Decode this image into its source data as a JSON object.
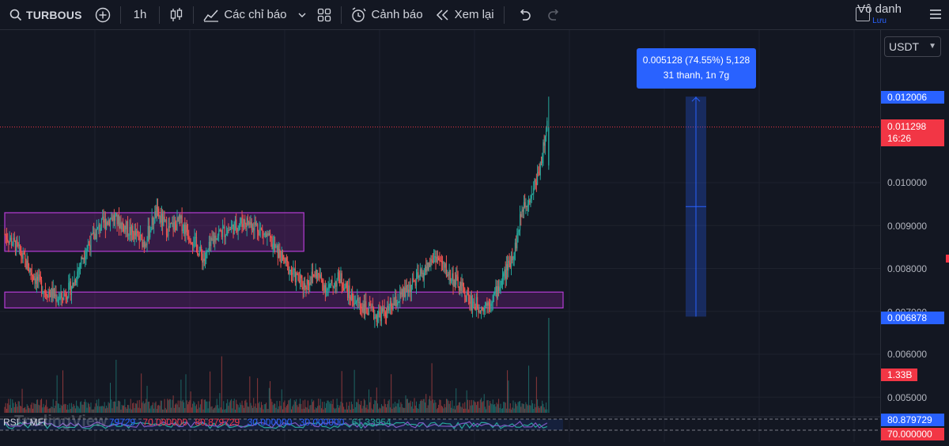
{
  "toolbar": {
    "symbol": "TURBOUS",
    "interval": "1h",
    "indicators_label": "Các chỉ báo",
    "alert_label": "Cảnh báo",
    "replay_label": "Xem lại",
    "user_name": "Vô danh",
    "save_label": "Lưu"
  },
  "icons": [
    "search-icon",
    "add-symbol-icon",
    "candles-icon",
    "indicators-icon",
    "chevron-down-icon",
    "templates-icon",
    "alarm-icon",
    "replay-icon",
    "undo-icon",
    "redo-icon",
    "layout-icon",
    "menu-icon"
  ],
  "colors": {
    "background": "#131722",
    "up": "#26a69a",
    "down": "#ef5350",
    "zone": "#9c27b0",
    "measure": "#2962ff",
    "last_price": "#f23645"
  },
  "price_scale": {
    "currency": "USDT",
    "ticks": [
      "0.010000",
      "0.009000",
      "0.008000",
      "0.007000",
      "0.006000",
      "0.005000"
    ],
    "measure_high": "0.012006",
    "last_price": "0.011298",
    "countdown": "16:26",
    "measure_low": "0.006878",
    "volume": "1.33B",
    "rsi_value": "80.879729",
    "rsi_level": "70.000000"
  },
  "measure": {
    "line1": "0.005128 (74.55%) 5,128",
    "line2": "31 thanh, 1n 7g"
  },
  "rsi_legend": {
    "name": "RSI + MFI",
    "values": [
      "79729",
      "70.000000",
      "80.879729",
      "30.000000",
      "30.000000",
      "61.33954"
    ]
  },
  "watermark": "TradingView",
  "chart_data": {
    "type": "candlestick",
    "symbol": "TURBOUS",
    "interval": "1h",
    "currency": "USDT",
    "ylim": [
      0.0045,
      0.0128
    ],
    "ticks": [
      0.01,
      0.009,
      0.008,
      0.007,
      0.006,
      0.005
    ],
    "last_price": 0.011298,
    "path": [
      [
        0,
        0.0088
      ],
      [
        3,
        0.0085
      ],
      [
        6,
        0.008
      ],
      [
        10,
        0.0075
      ],
      [
        14,
        0.0073
      ],
      [
        17,
        0.0076
      ],
      [
        20,
        0.0084
      ],
      [
        24,
        0.009
      ],
      [
        27,
        0.0092
      ],
      [
        31,
        0.0089
      ],
      [
        35,
        0.0086
      ],
      [
        38,
        0.0093
      ],
      [
        41,
        0.0089
      ],
      [
        44,
        0.0091
      ],
      [
        47,
        0.0087
      ],
      [
        50,
        0.0082
      ],
      [
        53,
        0.0088
      ],
      [
        56,
        0.0089
      ],
      [
        60,
        0.0091
      ],
      [
        63,
        0.009
      ],
      [
        66,
        0.0087
      ],
      [
        69,
        0.0083
      ],
      [
        72,
        0.0079
      ],
      [
        75,
        0.0076
      ],
      [
        78,
        0.0079
      ],
      [
        81,
        0.0075
      ],
      [
        84,
        0.0078
      ],
      [
        87,
        0.0073
      ],
      [
        90,
        0.0071
      ],
      [
        93,
        0.0069
      ],
      [
        96,
        0.007
      ],
      [
        99,
        0.0073
      ],
      [
        102,
        0.0076
      ],
      [
        105,
        0.0079
      ],
      [
        108,
        0.0083
      ],
      [
        111,
        0.0079
      ],
      [
        114,
        0.0076
      ],
      [
        117,
        0.0072
      ],
      [
        120,
        0.0071
      ],
      [
        123,
        0.0074
      ],
      [
        126,
        0.008
      ],
      [
        128,
        0.0085
      ],
      [
        130,
        0.0095
      ],
      [
        132,
        0.0097
      ],
      [
        134,
        0.0103
      ],
      [
        135,
        0.0108
      ],
      [
        136,
        0.01128
      ]
    ],
    "zones": [
      {
        "top": 0.0093,
        "bottom": 0.0084,
        "from": 0,
        "to": 75
      },
      {
        "top": 0.00745,
        "bottom": 0.00708,
        "from": 0,
        "to": 140
      }
    ],
    "measure": {
      "low": 0.006878,
      "high": 0.012006,
      "change": 0.005128,
      "percent": 74.55,
      "ticks": 5128,
      "bars": 31,
      "duration": "1n 7g"
    },
    "volume_last": "1.33B",
    "rsi": {
      "value": 80.879729,
      "overbought": 70,
      "oversold": 30
    }
  }
}
